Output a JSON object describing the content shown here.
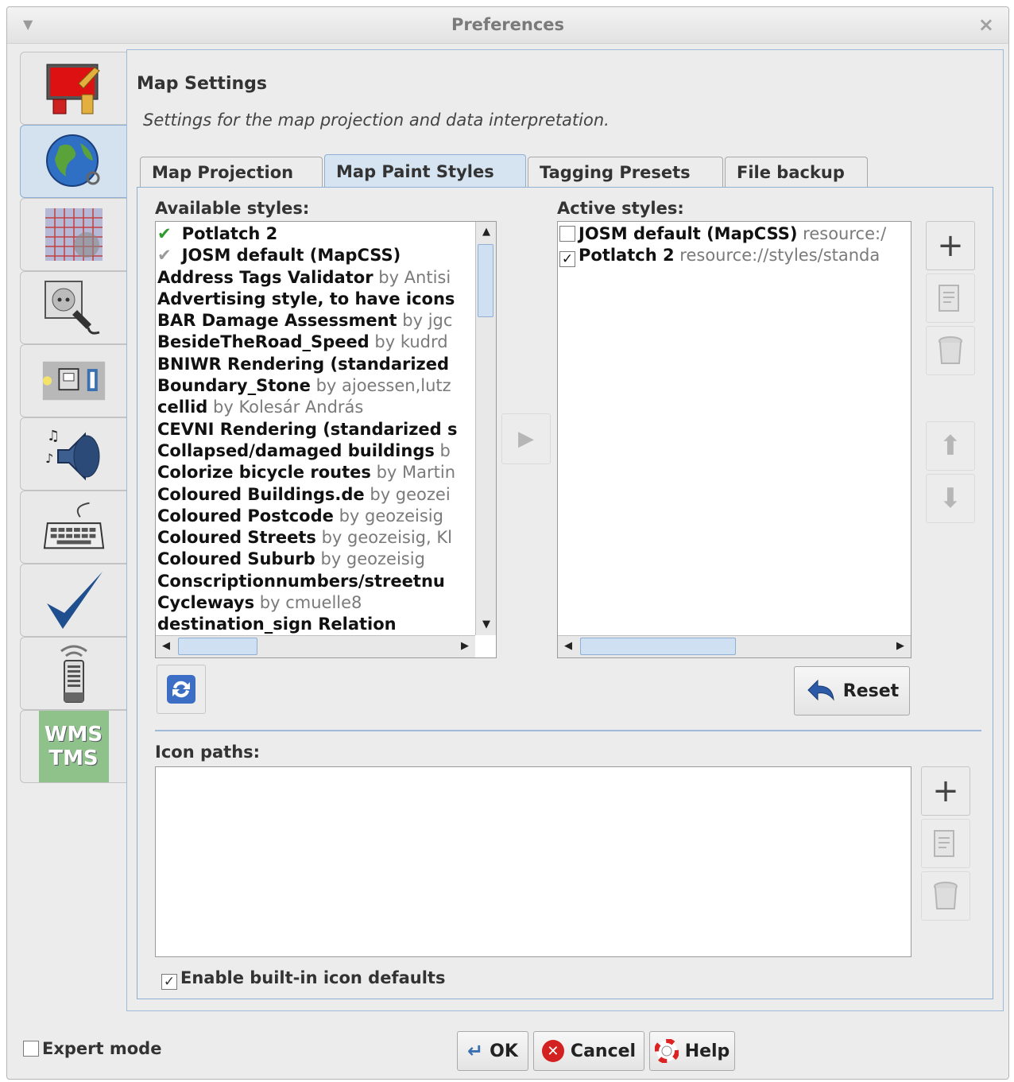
{
  "window": {
    "title": "Preferences"
  },
  "side_tabs": [
    {
      "name": "display-preferences-icon",
      "active": false
    },
    {
      "name": "map-settings-globe-icon",
      "active": true
    },
    {
      "name": "projection-grid-icon",
      "active": false
    },
    {
      "name": "connection-plug-icon",
      "active": false
    },
    {
      "name": "plugins-icon",
      "active": false
    },
    {
      "name": "audio-speaker-icon",
      "active": false
    },
    {
      "name": "shortcuts-keyboard-icon",
      "active": false
    },
    {
      "name": "validator-checkmark-icon",
      "active": false
    },
    {
      "name": "remote-control-icon",
      "active": false
    },
    {
      "name": "wms-tms-icon",
      "active": false,
      "label": "WMS TMS"
    }
  ],
  "pane": {
    "title": "Map Settings",
    "subtitle": "Settings for the map projection and data interpretation."
  },
  "tabs": [
    "Map Projection",
    "Map Paint Styles",
    "Tagging Presets",
    "File backup"
  ],
  "active_tab": "Map Paint Styles",
  "available": {
    "label": "Available styles:",
    "items": [
      {
        "name": "Potlatch 2",
        "by": "",
        "mark": "green"
      },
      {
        "name": "JOSM default (MapCSS)",
        "by": "",
        "mark": "gray"
      },
      {
        "name": "Address Tags Validator",
        "by": "by Antisi"
      },
      {
        "name": "Advertising style, to have icons",
        "by": ""
      },
      {
        "name": "BAR Damage Assessment",
        "by": "by jgc"
      },
      {
        "name": "BesideTheRoad_Speed",
        "by": "by kudrd"
      },
      {
        "name": "BNIWR Rendering (standarized",
        "by": ""
      },
      {
        "name": "Boundary_Stone",
        "by": "by ajoessen,lutz"
      },
      {
        "name": "cellid",
        "by": "by Kolesár András"
      },
      {
        "name": "CEVNI Rendering (standarized s",
        "by": ""
      },
      {
        "name": "Collapsed/damaged buildings",
        "by": "b"
      },
      {
        "name": "Colorize bicycle routes",
        "by": "by Martin"
      },
      {
        "name": "Coloured Buildings.de",
        "by": "by geozei"
      },
      {
        "name": "Coloured Postcode",
        "by": "by geozeisig"
      },
      {
        "name": "Coloured Streets",
        "by": "by geozeisig, Kl"
      },
      {
        "name": "Coloured Suburb",
        "by": "by geozeisig"
      },
      {
        "name": "Conscriptionnumbers/streetnu",
        "by": ""
      },
      {
        "name": "Cycleways",
        "by": "by cmuelle8"
      },
      {
        "name": "destination_sign Relation",
        "by": ""
      }
    ]
  },
  "active": {
    "label": "Active styles:",
    "items": [
      {
        "name": "JOSM default (MapCSS)",
        "source": "resource:/",
        "checked": false
      },
      {
        "name": "Potlatch 2",
        "source": "resource://styles/standa",
        "checked": true
      }
    ]
  },
  "reset_label": "Reset",
  "icon_paths": {
    "label": "Icon paths:"
  },
  "builtin_defaults": {
    "label": "Enable built-in icon defaults",
    "checked": true
  },
  "expert_mode": {
    "label": "Expert mode",
    "checked": false
  },
  "buttons": {
    "ok": "OK",
    "cancel": "Cancel",
    "help": "Help"
  }
}
